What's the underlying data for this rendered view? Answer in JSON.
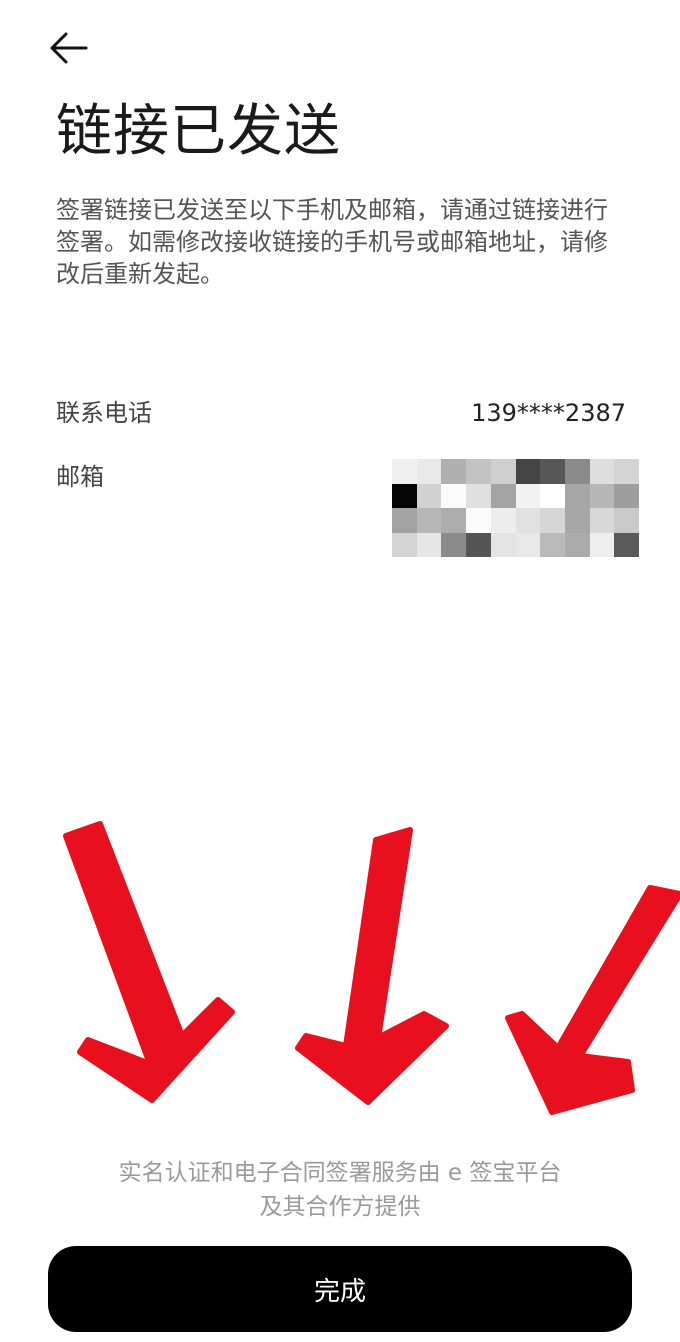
{
  "header": {
    "back_icon": "arrow-left-icon",
    "title": "链接已发送"
  },
  "description": {
    "lines": [
      "签署链接已发送至以下手机及邮箱，请通过链接进行",
      "签署。如需修改接收链接的手机号或邮箱地址，请修",
      "改后重新发起。"
    ]
  },
  "contact": {
    "phone_label": "联系电话",
    "phone_value": "139****2387",
    "email_label": "邮箱",
    "email_value_state": "pixelated",
    "mosaic_colors": [
      "#f0f0f0",
      "#e8e8e8",
      "#b0b0b0",
      "#c2c2c2",
      "#cfcfcf",
      "#444444",
      "#575757",
      "#8a8a8a",
      "#dedede",
      "#d4d4d4",
      "#050505",
      "#d2d2d2",
      "#fafafa",
      "#e0e0e0",
      "#a4a4a4",
      "#f2f2f2",
      "#ffffff",
      "#a6a6a6",
      "#b7b7b7",
      "#9e9e9e",
      "#a3a3a3",
      "#b8b8b8",
      "#adadad",
      "#fbfbfb",
      "#ededed",
      "#e1e1e1",
      "#d6d6d6",
      "#a7a7a7",
      "#d8d8d8",
      "#c9c9c9",
      "#d4d4d4",
      "#e6e6e6",
      "#8b8b8b",
      "#555555",
      "#e3e3e3",
      "#e8e8e8",
      "#b9b9b9",
      "#ababab",
      "#eeeeee",
      "#5a5a5a"
    ]
  },
  "annotation": {
    "arrow_icon": "red-down-arrow-icon",
    "color": "#e8101f"
  },
  "footer": {
    "lines": [
      "实名认证和电子合同签署服务由 e 签宝平台",
      "及其合作方提供"
    ],
    "done_label": "完成"
  }
}
